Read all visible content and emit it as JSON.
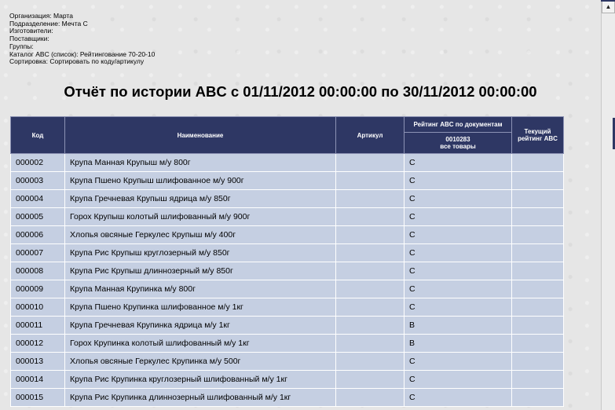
{
  "meta": [
    "Организация: Марта",
    "Подразделение: Мечта С",
    "Изготовители:",
    "Поставщики:",
    "Группы:",
    "Каталог ABC (список): Рейтингование 70-20-10",
    "Сортировка: Сортировать по коду/артикулу"
  ],
  "report": {
    "title": "Отчёт по истории ABC с 01/11/2012 00:00:00 по 30/11/2012 00:00:00",
    "columns": {
      "code": "Код",
      "name": "Наименование",
      "article": "Артикул",
      "rating_by_docs": "Рейтинг ABC по документам",
      "doc_number": "0010283",
      "all_goods": "все товары",
      "current_rating": "Текущий рейтинг ABC"
    },
    "rows": [
      {
        "code": "000002",
        "name": "Крупа Манная Крупыш м/у 800г",
        "article": "",
        "rating": "C",
        "current": ""
      },
      {
        "code": "000003",
        "name": "Крупа Пшено Крупыш шлифованное м/у 900г",
        "article": "",
        "rating": "C",
        "current": ""
      },
      {
        "code": "000004",
        "name": "Крупа Гречневая Крупыш ядрица м/у 850г",
        "article": "",
        "rating": "C",
        "current": ""
      },
      {
        "code": "000005",
        "name": "Горох Крупыш колотый шлифованный м/у 900г",
        "article": "",
        "rating": "C",
        "current": ""
      },
      {
        "code": "000006",
        "name": "Хлопья овсяные Геркулес Крупыш м/у 400г",
        "article": "",
        "rating": "C",
        "current": ""
      },
      {
        "code": "000007",
        "name": "Крупа Рис Крупыш круглозерный м/у 850г",
        "article": "",
        "rating": "C",
        "current": ""
      },
      {
        "code": "000008",
        "name": "Крупа Рис Крупыш длиннозерный м/у 850г",
        "article": "",
        "rating": "C",
        "current": ""
      },
      {
        "code": "000009",
        "name": "Крупа Манная Крупинка м/у 800г",
        "article": "",
        "rating": "C",
        "current": ""
      },
      {
        "code": "000010",
        "name": "Крупа Пшено Крупинка шлифованное м/у 1кг",
        "article": "",
        "rating": "C",
        "current": ""
      },
      {
        "code": "000011",
        "name": "Крупа Гречневая Крупинка ядрица м/у 1кг",
        "article": "",
        "rating": "B",
        "current": ""
      },
      {
        "code": "000012",
        "name": "Горох Крупинка колотый шлифованный м/у 1кг",
        "article": "",
        "rating": "B",
        "current": ""
      },
      {
        "code": "000013",
        "name": "Хлопья овсяные Геркулес Крупинка м/у 500г",
        "article": "",
        "rating": "C",
        "current": ""
      },
      {
        "code": "000014",
        "name": "Крупа Рис Крупинка круглозерный шлифованный м/у 1кг",
        "article": "",
        "rating": "C",
        "current": ""
      },
      {
        "code": "000015",
        "name": "Крупа Рис Крупинка длиннозерный шлифованный м/у 1кг",
        "article": "",
        "rating": "C",
        "current": ""
      }
    ]
  },
  "scrollbar": {
    "up_arrow_icon": "triangle-up-icon"
  },
  "colors": {
    "header_bg": "#2e3764",
    "row_bg": "#c5cfe2",
    "page_bg": "#e6e6e6"
  }
}
